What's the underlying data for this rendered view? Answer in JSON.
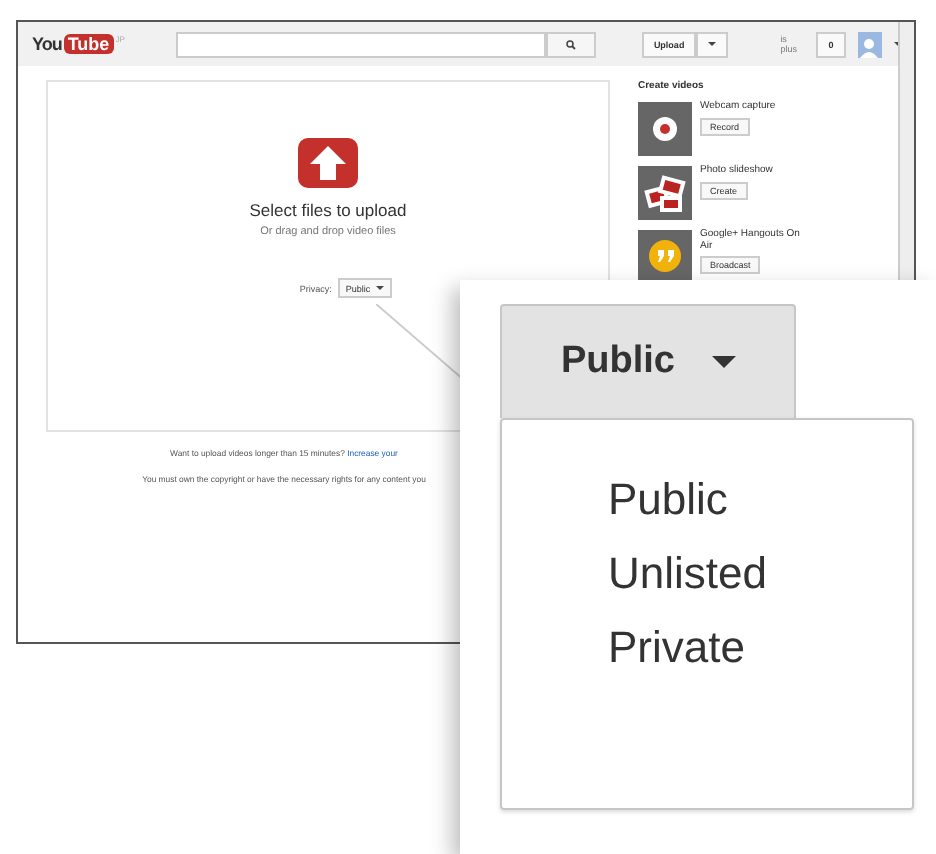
{
  "header": {
    "logo": {
      "you": "You",
      "tube": "Tube",
      "region": "JP"
    },
    "upload_button": "Upload",
    "user_label": "is plus",
    "notification_count": "0"
  },
  "upload": {
    "title": "Select files to upload",
    "subtitle": "Or drag and drop video files",
    "privacy_label": "Privacy:",
    "privacy_value": "Public"
  },
  "notes": [
    {
      "text": "Want to upload videos longer than 15 minutes? ",
      "link": "Increase your"
    },
    {
      "text": "You must own the copyright or have the necessary rights for any content you"
    }
  ],
  "sidebar": {
    "title": "Create videos",
    "items": [
      {
        "kind": "webcam",
        "title": "Webcam capture",
        "button": "Record"
      },
      {
        "kind": "slideshow",
        "title": "Photo slideshow",
        "button": "Create"
      },
      {
        "kind": "hangout",
        "title": "Google+ Hangouts On Air",
        "button": "Broadcast"
      }
    ]
  },
  "callout": {
    "button": "Public",
    "options": [
      {
        "label": "Public"
      },
      {
        "label": "Unlisted"
      },
      {
        "label": "Private"
      }
    ]
  }
}
